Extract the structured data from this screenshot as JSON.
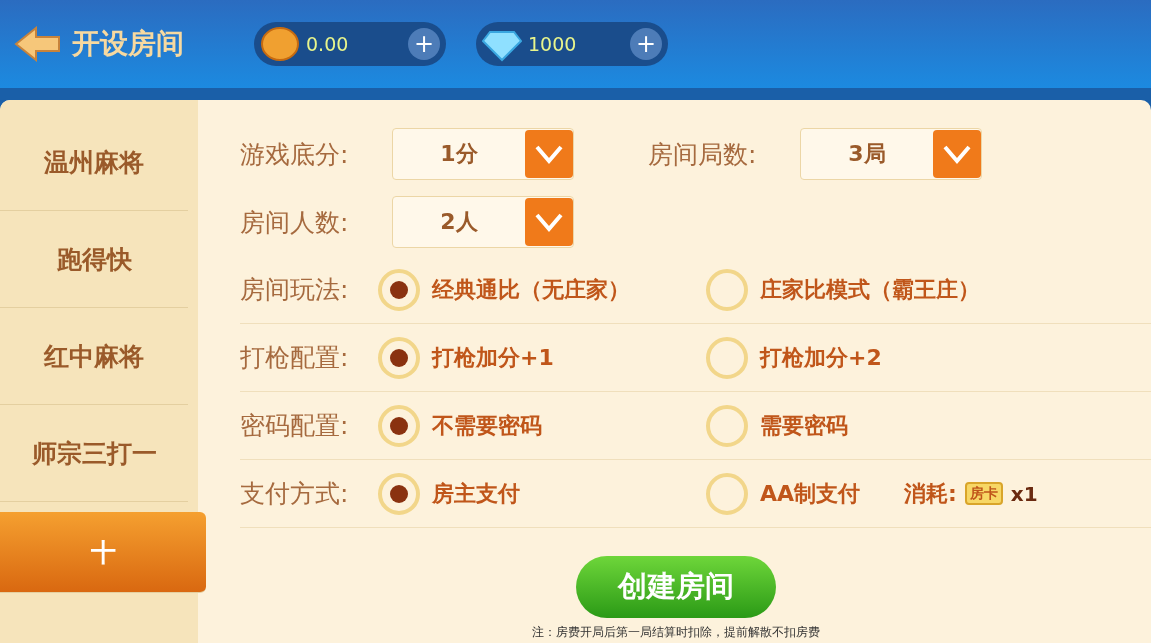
{
  "header": {
    "title": "开设房间",
    "currencies": [
      {
        "kind": "bean",
        "amount": "0.00",
        "add": "+"
      },
      {
        "kind": "diamond",
        "amount": "1000",
        "add": "+"
      }
    ]
  },
  "sidebar": {
    "items": [
      {
        "label": "温州麻将",
        "selected": false
      },
      {
        "label": "跑得快",
        "selected": false
      },
      {
        "label": "红中麻将",
        "selected": false
      },
      {
        "label": "师宗三打一",
        "selected": false
      },
      {
        "label": "十",
        "selected": true
      }
    ]
  },
  "selects": [
    {
      "label": "游戏底分:",
      "value": "1分"
    },
    {
      "label": "房间局数:",
      "value": "3局"
    },
    {
      "label": "房间人数:",
      "value": "2人"
    }
  ],
  "options": [
    {
      "label": "房间玩法:",
      "choices": [
        {
          "label": "经典通比（无庄家）",
          "selected": true
        },
        {
          "label": "庄家比模式（霸王庄）",
          "selected": false
        }
      ]
    },
    {
      "label": "打枪配置:",
      "choices": [
        {
          "label": "打枪加分+1",
          "selected": true
        },
        {
          "label": "打枪加分+2",
          "selected": false
        }
      ]
    },
    {
      "label": "密码配置:",
      "choices": [
        {
          "label": "不需要密码",
          "selected": true
        },
        {
          "label": "需要密码",
          "selected": false
        }
      ]
    },
    {
      "label": "支付方式:",
      "choices": [
        {
          "label": "房主支付",
          "selected": true
        },
        {
          "label": "AA制支付",
          "selected": false
        }
      ],
      "cost": {
        "label": "消耗:",
        "card": "房卡",
        "count": "x1"
      }
    }
  ],
  "create_button": "创建房间",
  "note": "注：房费开局后第一局结算时扣除，提前解散不扣房费"
}
